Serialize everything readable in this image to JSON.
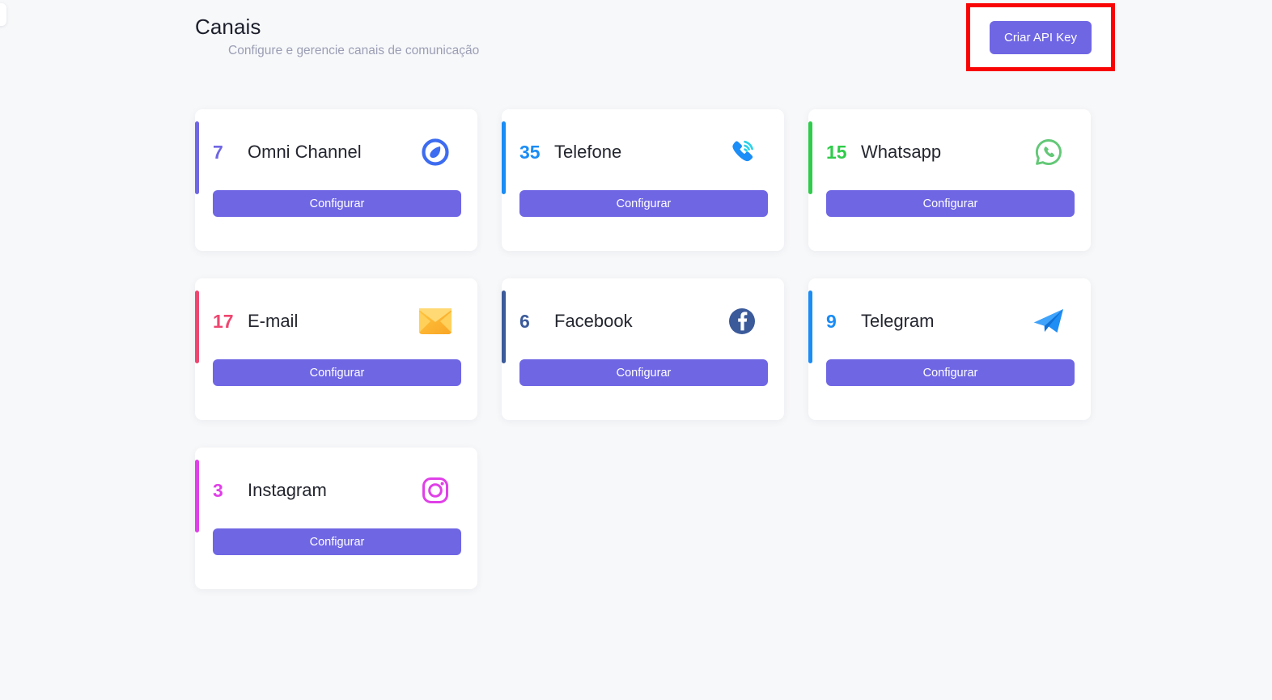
{
  "header": {
    "title": "Canais",
    "subtitle": "Configure e gerencie canais de comunicação"
  },
  "toolbar": {
    "api_key_label": "Criar API Key",
    "highlight_color": "#f90404"
  },
  "theme": {
    "background": "#f7f8fa",
    "card_background": "#ffffff",
    "primary_button": "#6f66e4",
    "button_text": "#ffffff",
    "title_text": "#1c1f2b",
    "subtitle_text": "#9b9eb4"
  },
  "cards": [
    {
      "count": "7",
      "label": "Omni Channel",
      "accent": "#6f66e4",
      "count_color": "#6f66e4",
      "icon": "omni-channel-icon",
      "button_label": "Configurar"
    },
    {
      "count": "35",
      "label": "Telefone",
      "accent": "#1a8cf5",
      "count_color": "#1a8cf5",
      "icon": "phone-signal-icon",
      "button_label": "Configurar"
    },
    {
      "count": "15",
      "label": "Whatsapp",
      "accent": "#2fcb4a",
      "count_color": "#2fcb4a",
      "icon": "whatsapp-icon",
      "button_label": "Configurar"
    },
    {
      "count": "17",
      "label": "E-mail",
      "accent": "#ef4670",
      "count_color": "#ef4670",
      "icon": "envelope-icon",
      "button_label": "Configurar"
    },
    {
      "count": "6",
      "label": "Facebook",
      "accent": "#3b5a9a",
      "count_color": "#3b5a9a",
      "icon": "facebook-icon",
      "button_label": "Configurar"
    },
    {
      "count": "9",
      "label": "Telegram",
      "accent": "#1a8cf5",
      "count_color": "#1a8cf5",
      "icon": "telegram-icon",
      "button_label": "Configurar"
    },
    {
      "count": "3",
      "label": "Instagram",
      "accent": "#e040e8",
      "count_color": "#e040e8",
      "icon": "instagram-icon",
      "button_label": "Configurar"
    }
  ]
}
